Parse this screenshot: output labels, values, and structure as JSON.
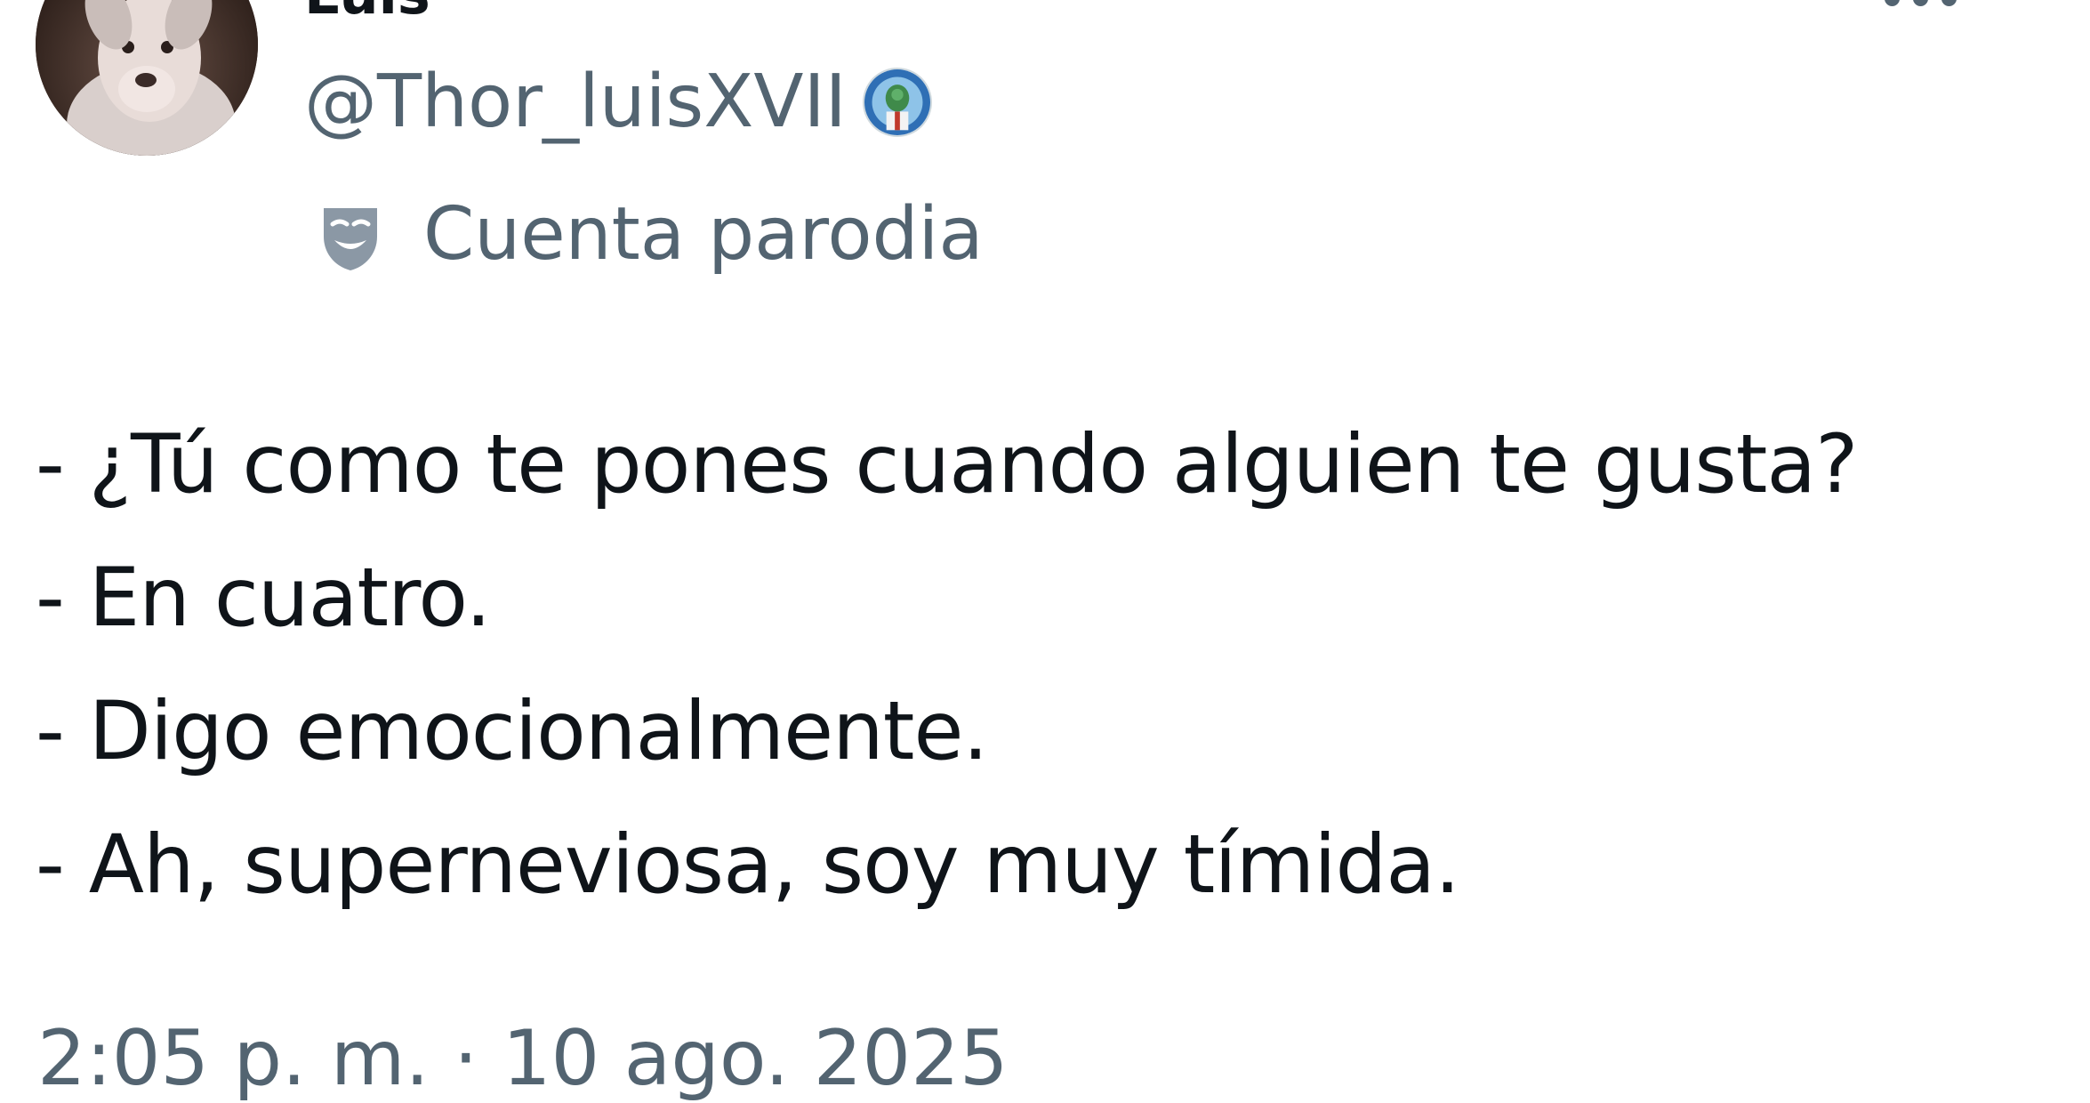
{
  "author": {
    "display_name": "Luis",
    "handle": "@Thor_luisXVII",
    "account_label": "Cuenta parodia"
  },
  "icons": {
    "avatar": "dog-avatar-photo",
    "affiliate_badge": "affiliate-badge-icon",
    "account_label_icon": "theater-mask-icon",
    "more": "more-options-icon"
  },
  "tweet": {
    "lines": [
      "- ¿Tú como te pones cuando alguien te gusta?",
      "- En cuatro.",
      "- Digo emocionalmente.",
      "- Ah, superneviosa, soy muy tímida."
    ],
    "timestamp": "2:05 p. m. · 10 ago. 2025"
  },
  "colors": {
    "primary_text": "#0f1419",
    "secondary_text": "#536471",
    "background": "#ffffff"
  }
}
